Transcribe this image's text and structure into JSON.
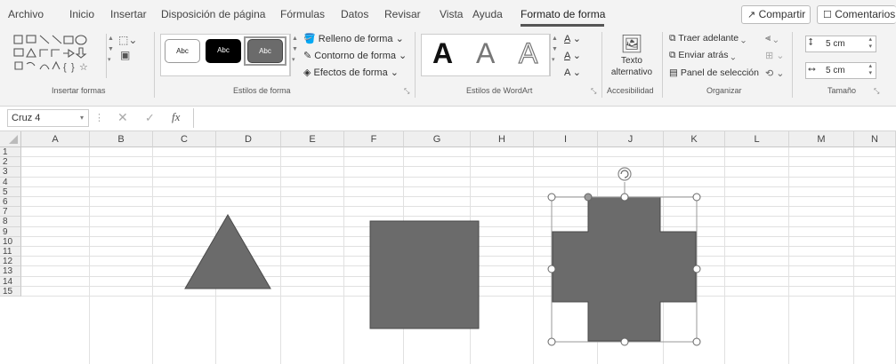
{
  "menu": {
    "tabs": [
      "Archivo",
      "Inicio",
      "Insertar",
      "Disposición de página",
      "Fórmulas",
      "Datos",
      "Revisar",
      "Vista",
      "Ayuda",
      "Formato de forma"
    ],
    "active_tab": "Formato de forma",
    "share_label": "Compartir",
    "comments_label": "Comentarios"
  },
  "ribbon": {
    "groups": {
      "insert_shapes": "Insertar formas",
      "shape_styles": "Estilos de forma",
      "wordart_styles": "Estilos de WordArt",
      "accessibility": "Accesibilidad",
      "arrange": "Organizar",
      "size": "Tamaño"
    },
    "style_presets": [
      "Abc",
      "Abc",
      "Abc"
    ],
    "shape_fill": "Relleno de forma",
    "shape_outline": "Contorno de forma",
    "shape_effects": "Efectos de forma",
    "wordart_letters": [
      "A",
      "A",
      "A"
    ],
    "alt_text": [
      "Texto",
      "alternativo"
    ],
    "bring_forward": "Traer adelante",
    "send_backward": "Enviar atrás",
    "selection_pane": "Panel de selección",
    "height": "5 cm",
    "width": "5 cm"
  },
  "formula_bar": {
    "name_box": "Cruz 4",
    "fx": "fx",
    "value": ""
  },
  "sheet": {
    "columns": [
      "A",
      "B",
      "C",
      "D",
      "E",
      "F",
      "G",
      "H",
      "I",
      "J",
      "K",
      "L",
      "M",
      "N"
    ],
    "rows": [
      "1",
      "2",
      "3",
      "4",
      "5",
      "6",
      "7",
      "8",
      "9",
      "10",
      "11",
      "12",
      "13",
      "14",
      "15"
    ],
    "shape_color": "#6b6b6b",
    "shapes": [
      "triangle",
      "square",
      "cross"
    ],
    "selected_shape": "Cruz 4"
  }
}
